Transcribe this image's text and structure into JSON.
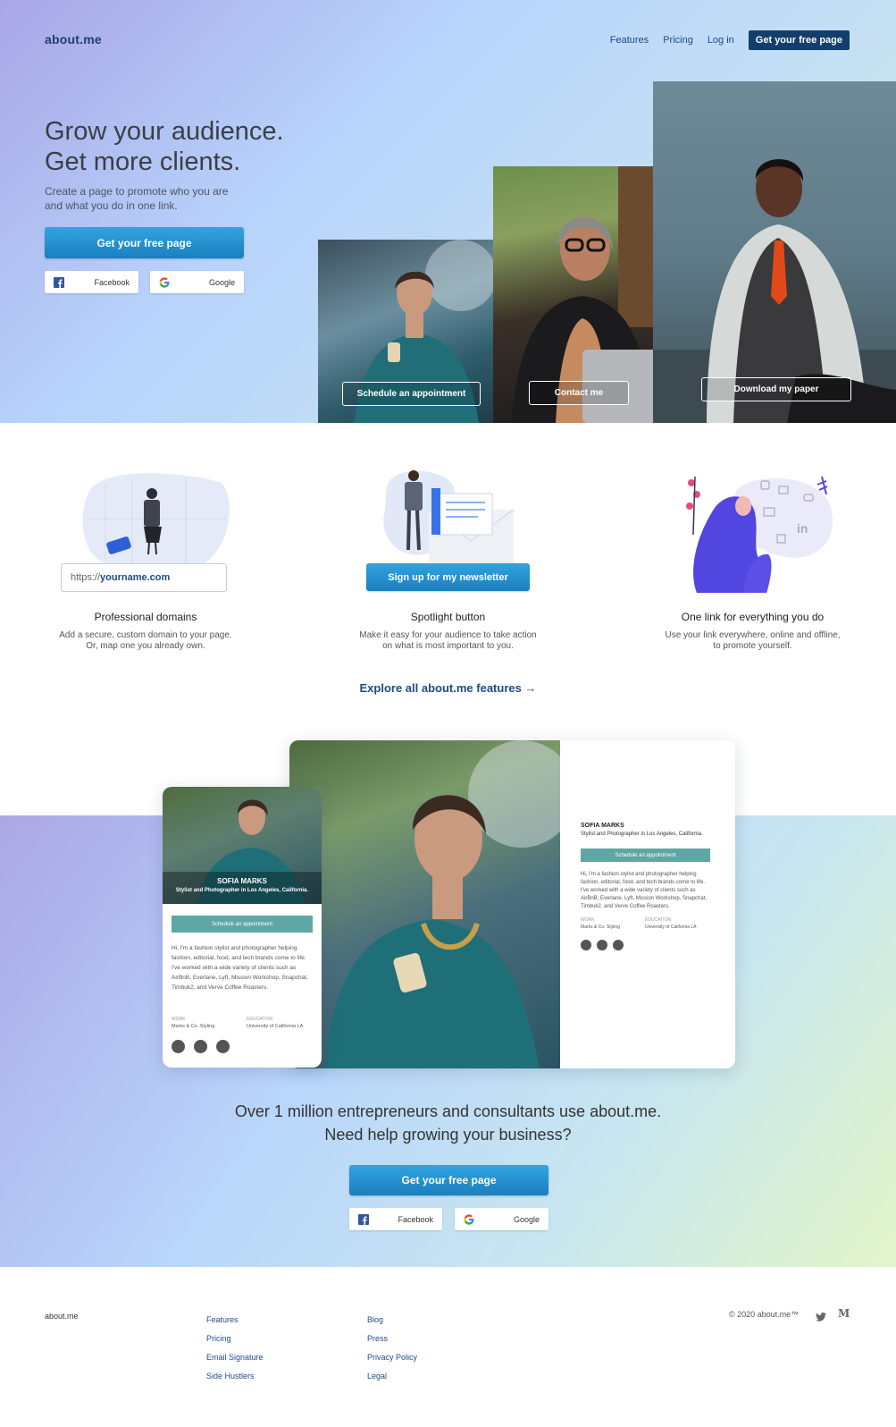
{
  "brand": "about.me",
  "nav": {
    "items": [
      "Features",
      "Pricing",
      "Log in"
    ],
    "cta": "Get your free page"
  },
  "hero": {
    "title_line1": "Grow your audience.",
    "title_line2": "Get more clients.",
    "subtitle_line1": "Create a page to promote who you are",
    "subtitle_line2": "and what you do in one link.",
    "cta": "Get your free page",
    "facebook_label": "Facebook",
    "google_label": "Google",
    "photo_buttons": [
      "Schedule an appointment",
      "Contact me",
      "Download my paper"
    ]
  },
  "features": [
    {
      "title": "Professional domains",
      "desc1": "Add a secure, custom domain to your page.",
      "desc2": "Or, map one you already own.",
      "url_prefix": "https://",
      "url_name": "yourname.com"
    },
    {
      "title": "Spotlight button",
      "desc1": "Make it easy for your audience to take action",
      "desc2": "on what is most important to you.",
      "button": "Sign up for my newsletter"
    },
    {
      "title": "One link for everything you do",
      "desc1": "Use your link everywhere, online and offline,",
      "desc2": "to promote yourself."
    }
  ],
  "explore": "Explore all about.me features →",
  "profile": {
    "name": "SOFIA MARKS",
    "tagline": "Stylist and Photographer in Los Angeles, California.",
    "button": "Schedule an appointment",
    "bio": "Hi, I'm a fashion stylist and photographer helping fashion, editorial, food, and tech brands come to life. I've worked with a wide variety of clients such as AirBnB, Everlane, Lyft, Mission Workshop, Snapchat, Timbuk2, and Verve Coffee Roasters.",
    "work_label": "WORK",
    "work": "Marks & Co. Styling",
    "edu_label": "EDUCATION",
    "edu": "University of California LA"
  },
  "cta_section": {
    "line1": "Over 1 million entrepreneurs and consultants use about.me.",
    "line2": "Need help growing your business?",
    "cta": "Get your free page",
    "facebook_label": "Facebook",
    "google_label": "Google"
  },
  "footer": {
    "logo": "about.me",
    "col1": [
      "Features",
      "Pricing",
      "Email Signature",
      "Side Hustlers"
    ],
    "col2": [
      "Blog",
      "Press",
      "Privacy Policy",
      "Legal"
    ],
    "copyright": "© 2020 about.me™",
    "social_icons": [
      "twitter-icon",
      "medium-icon"
    ]
  },
  "colors": {
    "primary": "#1b7fbf",
    "navy": "#123e6d",
    "teal": "#5fa7a5"
  }
}
